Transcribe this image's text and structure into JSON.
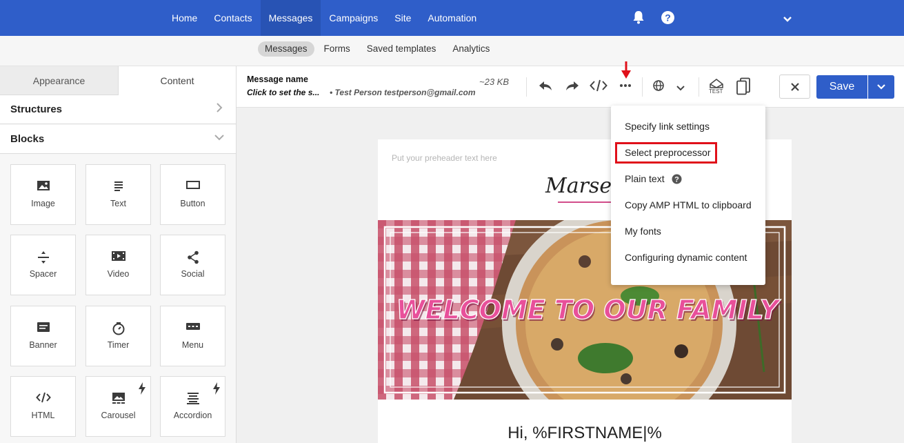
{
  "topnav": {
    "items": [
      {
        "label": "Home",
        "active": false
      },
      {
        "label": "Contacts",
        "active": false
      },
      {
        "label": "Messages",
        "active": true
      },
      {
        "label": "Campaigns",
        "active": false
      },
      {
        "label": "Site",
        "active": false
      },
      {
        "label": "Automation",
        "active": false
      }
    ],
    "icons": [
      "bell-icon",
      "help-icon",
      "chevron-down-icon"
    ],
    "bg_color": "#2f5ec9"
  },
  "subnav": {
    "items": [
      {
        "label": "Messages",
        "active": true
      },
      {
        "label": "Forms",
        "active": false
      },
      {
        "label": "Saved templates",
        "active": false
      },
      {
        "label": "Analytics",
        "active": false
      }
    ]
  },
  "left_panel": {
    "tabs": [
      {
        "label": "Appearance",
        "active": false
      },
      {
        "label": "Content",
        "active": true
      }
    ],
    "sections": {
      "structures": "Structures",
      "blocks": "Blocks"
    },
    "blocks": [
      {
        "label": "Image",
        "icon": "image-icon"
      },
      {
        "label": "Text",
        "icon": "text-icon"
      },
      {
        "label": "Button",
        "icon": "button-icon"
      },
      {
        "label": "Spacer",
        "icon": "spacer-icon"
      },
      {
        "label": "Video",
        "icon": "video-icon"
      },
      {
        "label": "Social",
        "icon": "share-icon"
      },
      {
        "label": "Banner",
        "icon": "banner-icon"
      },
      {
        "label": "Timer",
        "icon": "timer-icon"
      },
      {
        "label": "Menu",
        "icon": "menu-icon"
      },
      {
        "label": "HTML",
        "icon": "code-icon"
      },
      {
        "label": "Carousel",
        "icon": "carousel-icon",
        "amp": true
      },
      {
        "label": "Accordion",
        "icon": "accordion-icon",
        "amp": true
      }
    ]
  },
  "toolbar": {
    "message_name_label": "Message name",
    "subject": "Click to set the s...",
    "sender": "• Test Person testperson@gmail.com",
    "size": "~23 KB",
    "icons": [
      "undo-icon",
      "redo-icon",
      "code-icon",
      "more-icon",
      "globe-icon",
      "chevron-down-icon",
      "test-send-icon",
      "device-preview-icon"
    ],
    "test_label": "TEST",
    "close_icon": "close-icon",
    "save_label": "Save"
  },
  "email_preview": {
    "preheader": "Put your preheader text here",
    "logo_text": "Marseil",
    "hero_text": "WELCOME TO OUR FAMILY",
    "greeting": "Hi, %FIRSTNAME|%"
  },
  "more_menu": {
    "items": [
      {
        "label": "Specify link settings"
      },
      {
        "label": "Select preprocessor",
        "highlighted": true
      },
      {
        "label": "Plain text",
        "icon": "help-icon"
      },
      {
        "label": "Copy AMP HTML to clipboard"
      },
      {
        "label": "My fonts"
      },
      {
        "label": "Configuring dynamic content"
      }
    ]
  },
  "annotation_color": "#e0101a"
}
